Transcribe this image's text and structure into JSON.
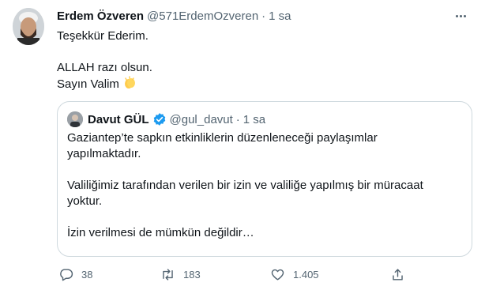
{
  "tweet": {
    "author_name": "Erdem Özveren",
    "author_handle": "@571ErdemOzveren",
    "separator": "·",
    "time": "1 sa",
    "lines": [
      "Teşekkür Ederim.",
      "",
      "ALLAH razı olsun.",
      "Sayın Valim"
    ],
    "emoji_icon": "clapping-hands-icon"
  },
  "quote": {
    "author_name": "Davut GÜL",
    "author_handle": "@gul_davut",
    "separator": "·",
    "time": "1 sa",
    "verified_icon": "verified-badge-icon",
    "paragraphs": [
      [
        "Gaziantep’te sapkın etkinliklerin düzenleneceği  paylaşımlar",
        "yapılmaktadır."
      ],
      [
        "Valiliğimiz tarafından verilen bir izin ve  valiliğe yapılmış bir müracaat",
        "yoktur."
      ],
      [
        "İzin verilmesi de mümkün değildir…"
      ]
    ]
  },
  "actions": {
    "reply_count": "38",
    "retweet_count": "183",
    "like_count": "1.405",
    "icons": [
      "reply-icon",
      "retweet-icon",
      "like-icon",
      "share-icon"
    ]
  },
  "colors": {
    "text": "#0f1419",
    "secondary": "#536471",
    "border": "#cfd9de",
    "verified": "#1d9bf0",
    "emoji": "#ffcc4d"
  }
}
